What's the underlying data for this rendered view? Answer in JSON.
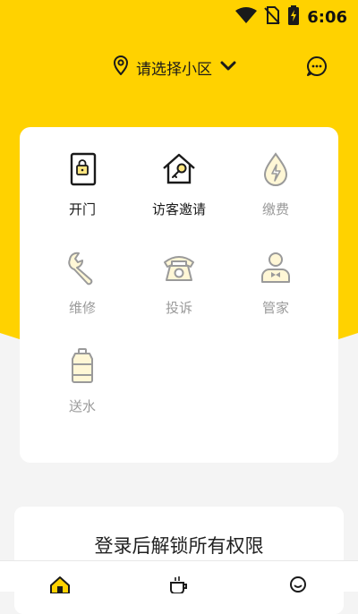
{
  "status_bar": {
    "time": "6:06",
    "icons": [
      "wifi-icon",
      "no-sim-icon",
      "battery-charging-icon"
    ]
  },
  "header": {
    "location_label": "请选择小区",
    "icons": [
      "location-pin-icon",
      "chevron-down-icon",
      "chat-bubble-icon"
    ]
  },
  "services": [
    {
      "label": "开门",
      "icon": "door-lock-icon",
      "enabled": true
    },
    {
      "label": "访客邀请",
      "icon": "house-key-icon",
      "enabled": true
    },
    {
      "label": "缴费",
      "icon": "water-drop-bolt-icon",
      "enabled": false
    },
    {
      "label": "维修",
      "icon": "wrench-icon",
      "enabled": false
    },
    {
      "label": "投诉",
      "icon": "telephone-icon",
      "enabled": false
    },
    {
      "label": "管家",
      "icon": "butler-icon",
      "enabled": false
    },
    {
      "label": "送水",
      "icon": "water-bottle-icon",
      "enabled": false
    }
  ],
  "login_prompt": "登录后解锁所有权限",
  "tabbar": {
    "items": [
      "home-icon",
      "coffee-cup-icon",
      "smiley-icon"
    ]
  },
  "colors": {
    "accent": "#FFD200",
    "background": "#f4f4f4",
    "icon_stroke": "#1a1a1a",
    "disabled_text": "#9a9a9a"
  }
}
